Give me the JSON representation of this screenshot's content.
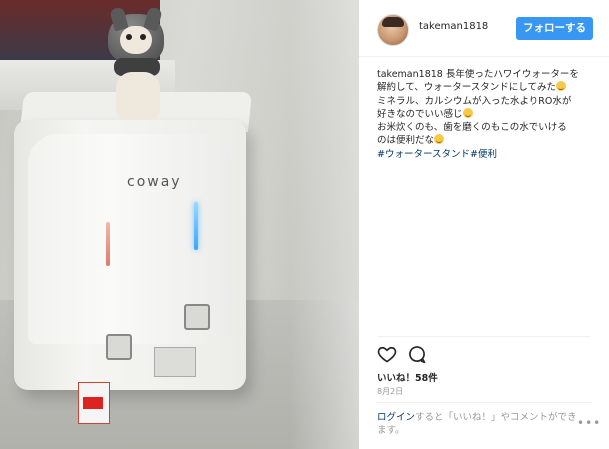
{
  "post": {
    "username": "takeman1818",
    "follow_label": "フォローする",
    "caption": {
      "user": "takeman1818",
      "lines": [
        "長年使ったハワイウォーターを",
        "解約して、ウォータースタンドにしてみた",
        "ミネラル、カルシウムが入った水よりRO水が",
        "好きなのでいい感じ",
        "お米炊くのも、歯を磨くのもこの水でいける",
        "のは便利だな"
      ],
      "hashtags": [
        "#ウォータースタンド",
        "#便利"
      ]
    },
    "likes": "いいね！58件",
    "date": "8月2日",
    "login_link": "ログイン",
    "login_text": "すると「いいね！」やコメントができます。",
    "more": "•••"
  },
  "photo": {
    "brand_label": "coway"
  },
  "icons": {
    "like": "heart-icon",
    "comment": "comment-icon",
    "more": "more-dots-icon"
  },
  "colors": {
    "follow_button": "#3897f0",
    "link": "#003569",
    "muted": "#999999"
  }
}
